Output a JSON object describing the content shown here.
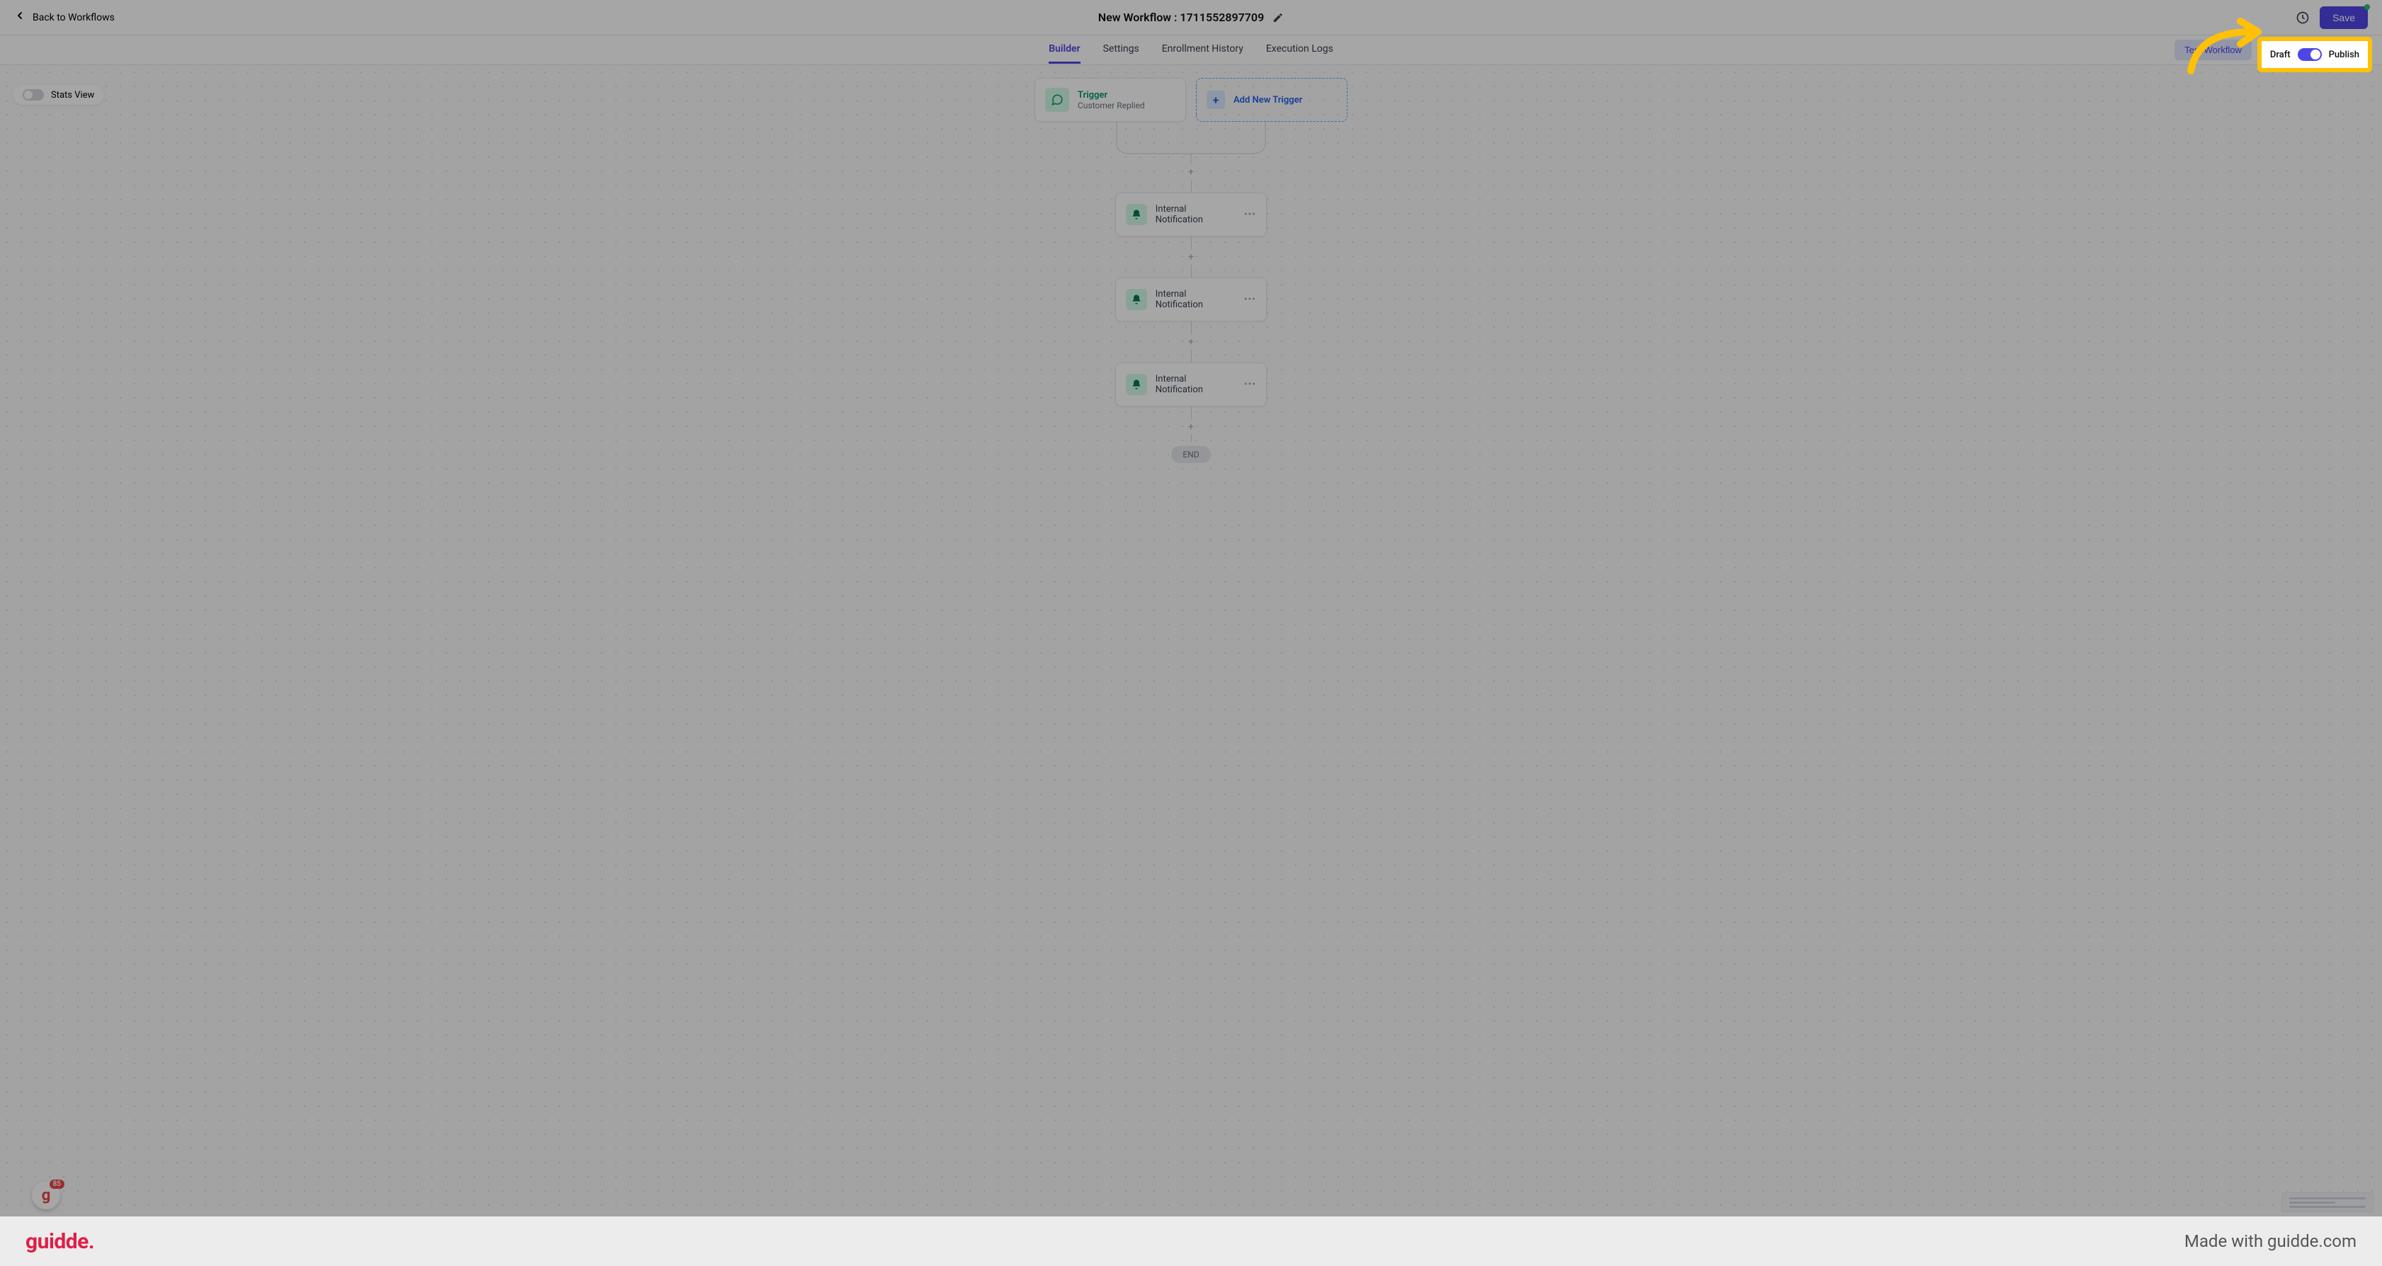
{
  "topbar": {
    "back_label": "Back to Workflows",
    "title": "New Workflow : 1711552897709",
    "save_label": "Save"
  },
  "tabs": [
    {
      "label": "Builder",
      "active": true
    },
    {
      "label": "Settings",
      "active": false
    },
    {
      "label": "Enrollment History",
      "active": false
    },
    {
      "label": "Execution Logs",
      "active": false
    }
  ],
  "secondbar": {
    "test_label": "Test Workflow",
    "draft_label": "Draft",
    "publish_label": "Publish"
  },
  "stats_view_label": "Stats View",
  "trigger": {
    "title": "Trigger",
    "subtitle": "Customer Replied"
  },
  "add_trigger_label": "Add New Trigger",
  "actions": [
    {
      "label": "Internal Notification"
    },
    {
      "label": "Internal Notification"
    },
    {
      "label": "Internal Notification"
    }
  ],
  "end_label": "END",
  "help_badge_count": "85",
  "footer": {
    "logo": "guidde.",
    "made_with": "Made with guidde.com"
  }
}
